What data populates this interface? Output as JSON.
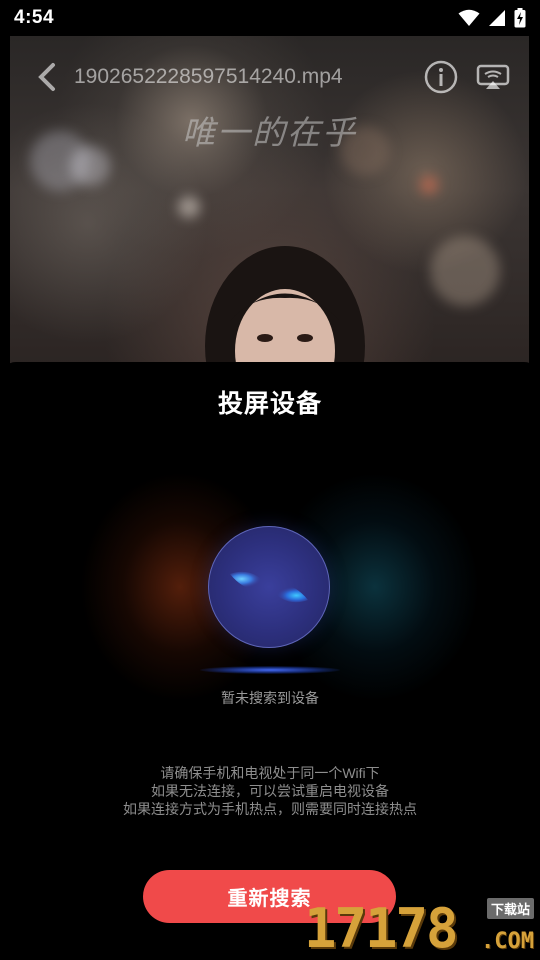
{
  "status_bar": {
    "time": "4:54"
  },
  "video": {
    "filename": "1902652228597514240.mp4",
    "caption": "唯一的在乎"
  },
  "sheet": {
    "title": "投屏设备",
    "search_status": "暂未搜索到设备",
    "hints": [
      "请确保手机和电视处于同一个Wifi下",
      "如果无法连接，可以尝试重启电视设备",
      "如果连接方式为手机热点，则需要同时连接热点"
    ],
    "retry_label": "重新搜索"
  },
  "watermark": {
    "digits": "17178",
    "domain": ".COM",
    "badge": "下载站"
  },
  "colors": {
    "accent": "#f04a4a",
    "background": "#000000",
    "watermark": "#d6a23a"
  }
}
